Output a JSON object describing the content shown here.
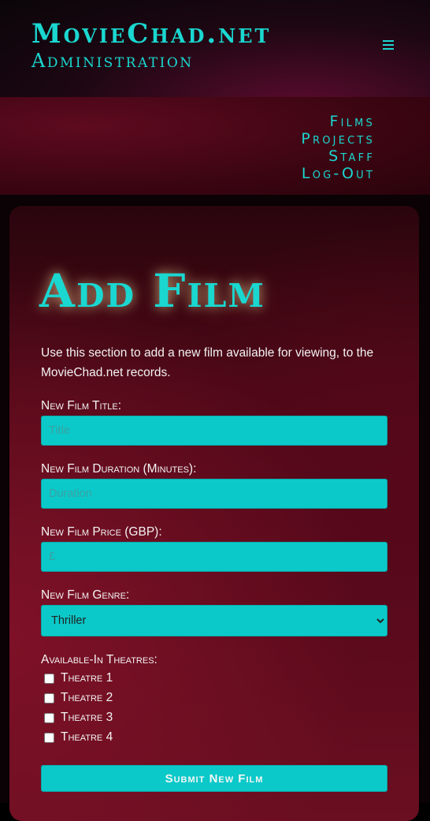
{
  "header": {
    "brand": "MovieChad.net",
    "subtitle": "Administration",
    "menu_icon": "hamburger-menu-icon"
  },
  "nav": {
    "items": [
      {
        "label": "Films"
      },
      {
        "label": "Projects"
      },
      {
        "label": "Staff"
      },
      {
        "label": "Log-Out"
      }
    ]
  },
  "page": {
    "title": "Add Film",
    "intro": "Use this section to add a new film available for viewing, to the MovieChad.net records."
  },
  "form": {
    "title_label": "New Film Title:",
    "title_placeholder": "Title",
    "duration_label": "New Film Duration (Minutes):",
    "duration_placeholder": "Duration",
    "price_label": "New Film Price (GBP):",
    "price_placeholder": "£",
    "genre_label": "New Film Genre:",
    "genre_selected": "Thriller",
    "theatres_label": "Available-In Theatres:",
    "theatres": [
      {
        "label": "Theatre 1",
        "checked": false
      },
      {
        "label": "Theatre 2",
        "checked": false
      },
      {
        "label": "Theatre 3",
        "checked": false
      },
      {
        "label": "Theatre 4",
        "checked": false
      }
    ],
    "submit_label": "Submit New Film"
  },
  "colors": {
    "accent": "#1ad7d0",
    "input_bg": "#0bc9c9",
    "text": "#f3f3f3"
  }
}
